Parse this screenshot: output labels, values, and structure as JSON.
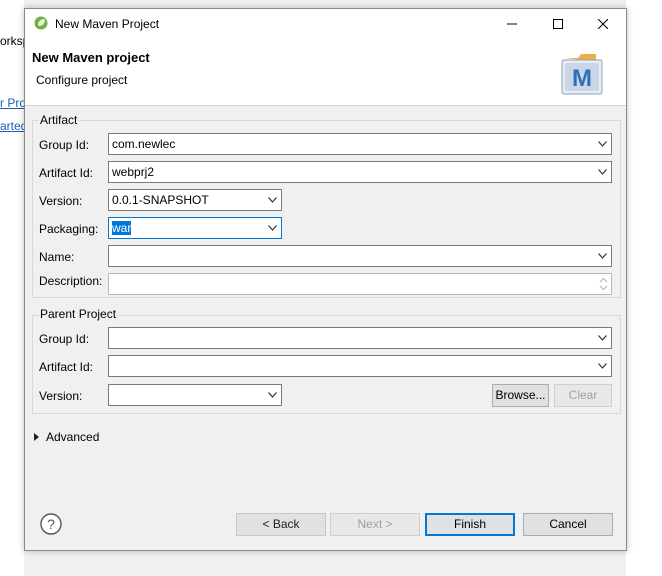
{
  "background": {
    "workspace_fragment": "orksp",
    "link1_fragment": "r Pro",
    "link2_fragment": "arted"
  },
  "window": {
    "title": "New Maven Project",
    "app_icon": "spring-leaf-icon",
    "controls": [
      "minimize-icon",
      "maximize-icon",
      "close-icon"
    ]
  },
  "header": {
    "title": "New Maven project",
    "subtitle": "Configure project",
    "logo_letter": "M"
  },
  "artifact": {
    "legend": "Artifact",
    "group_id_label": "Group Id:",
    "group_id_value": "com.newlec",
    "artifact_id_label": "Artifact Id:",
    "artifact_id_value": "webprj2",
    "version_label": "Version:",
    "version_value": "0.0.1-SNAPSHOT",
    "packaging_label": "Packaging:",
    "packaging_value": "war",
    "name_label": "Name:",
    "name_value": "",
    "description_label": "Description:",
    "description_value": ""
  },
  "parent": {
    "legend": "Parent Project",
    "group_id_label": "Group Id:",
    "group_id_value": "",
    "artifact_id_label": "Artifact Id:",
    "artifact_id_value": "",
    "version_label": "Version:",
    "version_value": "",
    "browse_label": "Browse...",
    "clear_label": "Clear"
  },
  "advanced": {
    "label": "Advanced",
    "expanded": false
  },
  "footer": {
    "help_icon": "help-icon",
    "back_label": "< Back",
    "next_label": "Next >",
    "finish_label": "Finish",
    "cancel_label": "Cancel"
  },
  "colors": {
    "accent": "#0078d7",
    "link": "#1a5fb4",
    "dialog_bg": "#f0f0f0",
    "maven_blue": "#2f6fb5",
    "folder_orange": "#f0a030"
  }
}
